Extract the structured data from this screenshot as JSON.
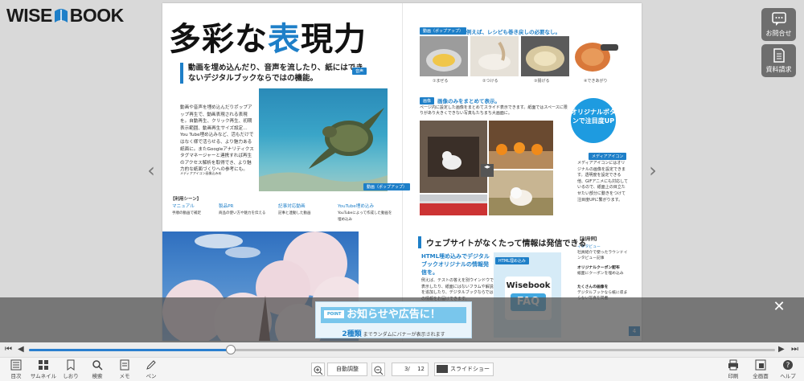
{
  "app": {
    "logo_left": "WISE",
    "logo_right": "BOOK"
  },
  "side_buttons": [
    {
      "label": "お問合せ",
      "icon": "chat-icon"
    },
    {
      "label": "資料請求",
      "icon": "document-icon"
    }
  ],
  "page": {
    "title_a": "多彩な",
    "title_b": "表",
    "title_c": "現力",
    "lead": "動画を埋め込んだり、音声を流したり、紙にはできないデジタルブックならではの機能。",
    "tag_voice": "音声",
    "intro": "動画や音声を埋め込んだりポップアップ再生で、動画表現される表現を。自動再生、クリック再生、初期表示範囲、動画再生サイズ設定… You Tube埋め込みなど、活もだけではなく様で活らせる、より魅力ある紙面に。またGoogleアナリティクスタグマネージャーと連携すれば再生のアクセス解析を取得でき、より魅力的な紙面づくりへの参考にも。",
    "intro_note": "メディアアイコン画像込みめ",
    "video_tag": "動画（ポップアップ）",
    "usage_title": "【利用シーン】",
    "usage": [
      {
        "title": "マニュアル",
        "text": "手順の動画で補足"
      },
      {
        "title": "製品PR",
        "text": "商品の使い方や魅力を伝える"
      },
      {
        "title": "記事対応動画",
        "text": "記事と連動した動画"
      },
      {
        "title": "YouTube埋め込み",
        "text": "YouTubeによって作成した動画を埋め込み"
      }
    ],
    "popup_tag": "動画（ポップアップ）",
    "popup_head": "例えば、レシピも巻き戻しの必要なし。",
    "steps": [
      "①まぜる",
      "②つける",
      "③揚げる",
      "④できあがり"
    ],
    "image_tag": "画像",
    "image_head": "画像のみをまとめて表示。",
    "image_text": "ページ内に設定した画像をまとめてスライド表示できます。紙面ではスペースに限りがあり大きくできない写真もたちまち大画面に。",
    "bubble": "オリジナルボタンで注目度UP",
    "media_tag": "メディアアイコン",
    "media_text": "メディアアイコンにはオリジナルの画像を設定できます。透明度を設定できる他、GIFアニメにも対応しているので、紙面上の目立たせたい部分に動きをつけて注目度UPに繋がります。",
    "section_title": "ウェブサイトがなくたって情報は発信できる",
    "html_head": "HTML埋め込みでデジタルブックオリジナルの情報発信を。",
    "html_text": "例えば、テストの答えを別ウインドウで表示したり、紙面にはないフラムや解説を追加したり、デジタルブックならではの情報をお届けできます。",
    "html_tag": "HTML埋め込み",
    "faq_logo": "Wisebook",
    "faq_text": "FAQ",
    "right_usage_title": "【利用例】",
    "right_usage": [
      {
        "title": "インタビュー",
        "text": "社員紹介で使ったラウンドインタビュー記事"
      },
      {
        "title": "オリジナルクーポン配布",
        "text": "紙面にクーポンを埋め込み"
      },
      {
        "title": "たくさんの画像を",
        "text": "デジタルブックなら紙に収まらない写真を掲載"
      }
    ],
    "page_number": "4"
  },
  "banner": {
    "point": "POINT",
    "main": "お知らせや広告に！",
    "count": "2種類",
    "sub": "までランダムにバナーが表示されます"
  },
  "slider": {
    "progress": 0.27
  },
  "toolbar": {
    "items": [
      {
        "label": "目次",
        "icon": "toc-icon"
      },
      {
        "label": "サムネイル",
        "icon": "thumbnail-icon"
      },
      {
        "label": "しおり",
        "icon": "bookmark-icon"
      },
      {
        "label": "検索",
        "icon": "search-icon"
      },
      {
        "label": "メモ",
        "icon": "memo-icon"
      },
      {
        "label": "ペン",
        "icon": "pen-icon"
      }
    ],
    "zoom_label": "自動調整",
    "page_current": "3/",
    "page_total": "12",
    "slideshow": "スライドショー",
    "right_items": [
      {
        "label": "印刷",
        "icon": "print-icon"
      },
      {
        "label": "全画面",
        "icon": "fullscreen-icon"
      },
      {
        "label": "ヘルプ",
        "icon": "help-icon"
      }
    ]
  },
  "colors": {
    "accent": "#1e7fc8",
    "banner": "#79c6ec",
    "overlay": "#505050"
  }
}
